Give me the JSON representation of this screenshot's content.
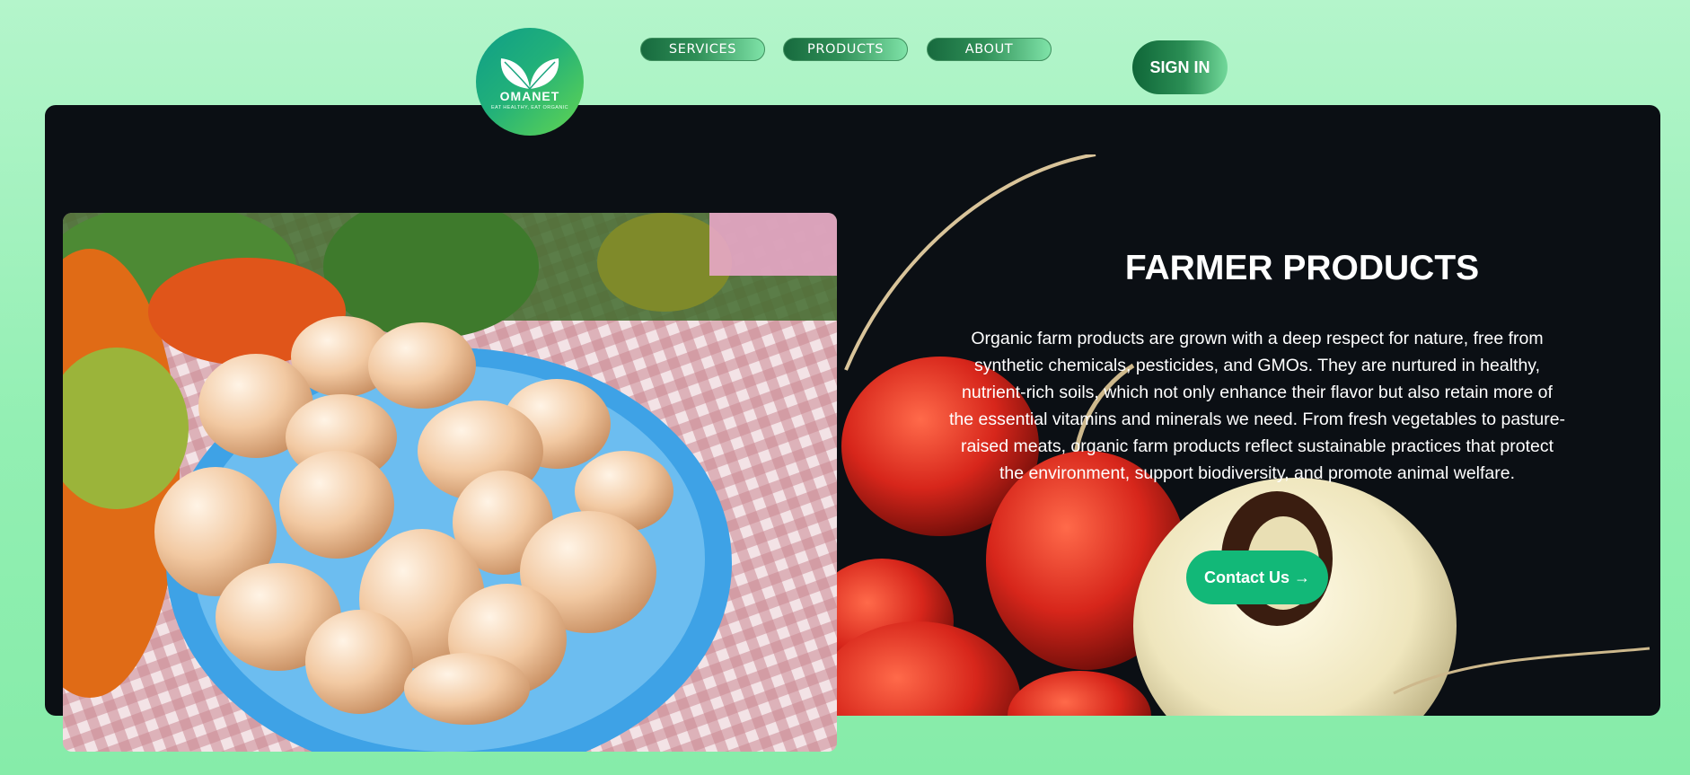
{
  "nav": {
    "logo": {
      "name": "OMANET",
      "tagline": "EAT HEALTHY, EAT ORGANIC"
    },
    "items": [
      {
        "label": "SERVICES"
      },
      {
        "label": "PRODUCTS"
      },
      {
        "label": "ABOUT"
      }
    ],
    "signin_label": "SIGN IN"
  },
  "hero": {
    "title": "FARMER PRODUCTS",
    "description": "Organic farm products are grown with a deep respect for nature, free from synthetic chemicals, pesticides, and GMOs. They are nurtured in healthy, nutrient-rich soils, which not only enhance their flavor but also retain more of the essential vitamins and minerals we need. From fresh vegetables to pasture-raised meats, organic farm products reflect sustainable practices that protect the environment, support biodiversity, and promote animal welfare.",
    "cta_label": "Contact Us →",
    "background_image": "radishes-photo",
    "feature_image": "eggs-basket-photo"
  },
  "colors": {
    "page_bg": "#9ff0bd",
    "hero_bg": "#0b0f14",
    "accent": "#12b878",
    "nav_pill": "#1e7a47"
  }
}
